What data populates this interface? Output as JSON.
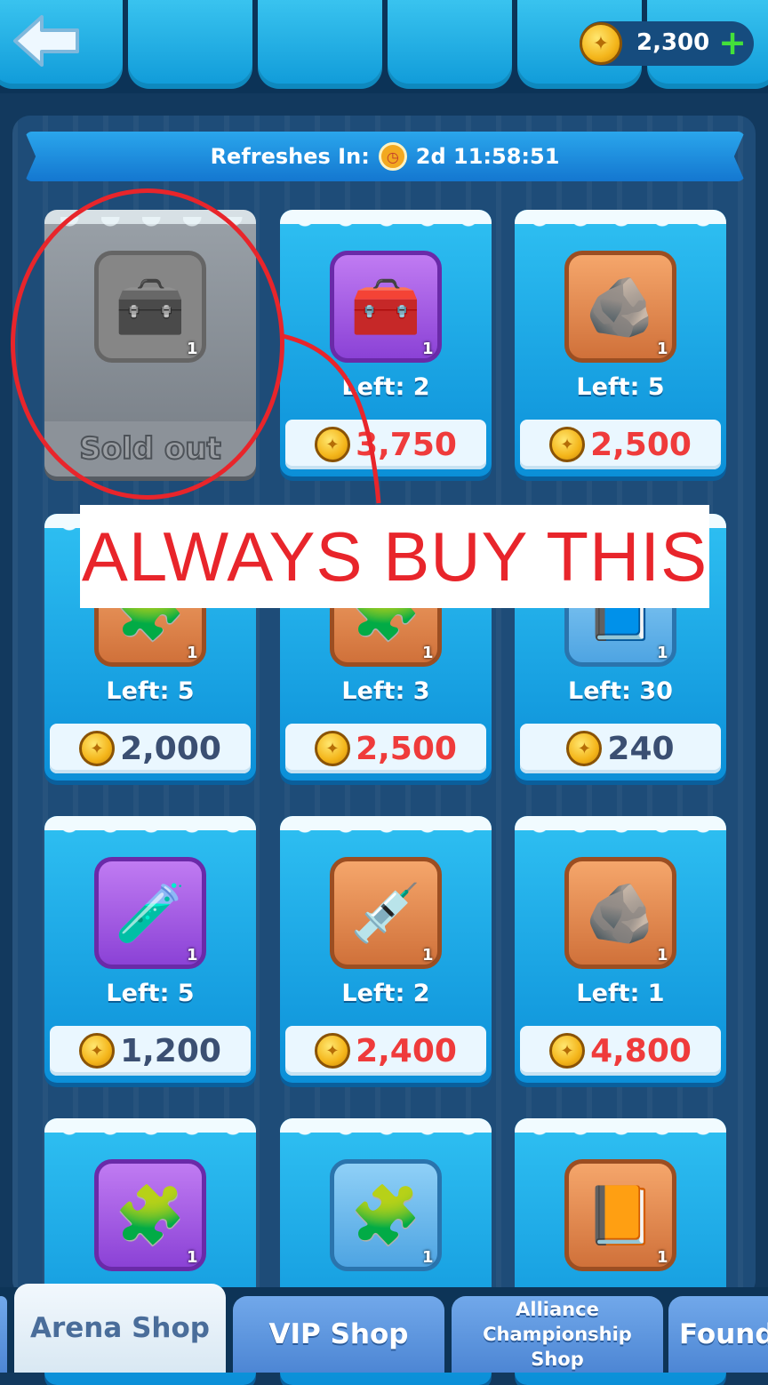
{
  "header": {
    "currency": {
      "icon": "coin-icon",
      "value": "2,300",
      "add_icon": "plus-icon"
    }
  },
  "refresh": {
    "label": "Refreshes In:",
    "time": "2d 11:58:51"
  },
  "shop_items": [
    {
      "id": "item1",
      "icon": "gray-treasure-chest-icon",
      "glyph": "🧰",
      "rarity": "gray",
      "qty": "1",
      "sold_out": true,
      "sold_label": "Sold out"
    },
    {
      "id": "item2",
      "icon": "treasure-chest-icon",
      "glyph": "🧰",
      "rarity": "purple",
      "qty": "1",
      "left": "Left: 2",
      "price": "3,750",
      "price_color": "red"
    },
    {
      "id": "item3",
      "icon": "forge-stone-icon",
      "glyph": "🪨",
      "rarity": "orange",
      "qty": "1",
      "left": "Left: 5",
      "price": "2,500",
      "price_color": "red"
    },
    {
      "id": "item4",
      "icon": "puzzle-piece-icon",
      "glyph": "🧩",
      "rarity": "orange",
      "qty": "1",
      "left": "Left: 5",
      "price": "2,000",
      "price_color": "dark"
    },
    {
      "id": "item5",
      "icon": "puzzle-piece-icon",
      "glyph": "🧩",
      "rarity": "orange",
      "qty": "1",
      "left": "Left: 3",
      "price": "2,500",
      "price_color": "red"
    },
    {
      "id": "item6",
      "icon": "book-icon",
      "glyph": "📘",
      "rarity": "blue",
      "qty": "1",
      "left": "Left: 30",
      "price": "240",
      "price_color": "dark"
    },
    {
      "id": "item7",
      "icon": "potion-icon",
      "glyph": "🧪",
      "rarity": "purple",
      "qty": "1",
      "left": "Left: 5",
      "price": "1,200",
      "price_color": "dark"
    },
    {
      "id": "item8",
      "icon": "syringe-icon",
      "glyph": "💉",
      "rarity": "orange",
      "qty": "1",
      "left": "Left: 2",
      "price": "2,400",
      "price_color": "red"
    },
    {
      "id": "item9",
      "icon": "claw-stone-icon",
      "glyph": "🪨",
      "rarity": "orange",
      "qty": "1",
      "left": "Left: 1",
      "price": "4,800",
      "price_color": "red"
    },
    {
      "id": "item10",
      "icon": "purple-puzzle-piece-icon",
      "glyph": "🧩",
      "rarity": "purple",
      "qty": "1"
    },
    {
      "id": "item11",
      "icon": "blue-puzzle-piece-icon",
      "glyph": "🧩",
      "rarity": "blue",
      "qty": "1"
    },
    {
      "id": "item12",
      "icon": "skill-book-icon",
      "glyph": "📙",
      "rarity": "orange",
      "qty": "1"
    }
  ],
  "annotation": {
    "label": "ALWAYS BUY THIS",
    "color": "#e8252b"
  },
  "tabs": [
    {
      "label": "Arena Shop",
      "active": true
    },
    {
      "label": "VIP Shop",
      "active": false
    },
    {
      "label": "Alliance Championship Shop",
      "active": false
    },
    {
      "label": "Found",
      "active": false
    }
  ]
}
